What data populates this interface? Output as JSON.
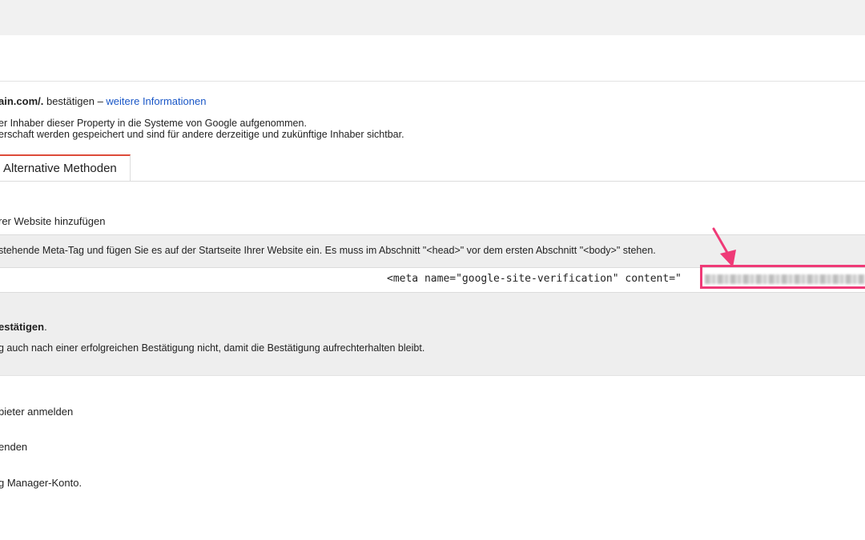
{
  "header": {
    "verify_domain_fragment": "ain.com/.",
    "verify_text": " bestätigen – ",
    "more_info_link": "weitere Informationen"
  },
  "info": {
    "line1": "er Inhaber dieser Property in die Systeme von Google aufgenommen.",
    "line2": "erschaft werden gespeichert und sind für andere derzeitige und zukünftige Inhaber sichtbar."
  },
  "tabs": {
    "active_label": "Alternative Methoden"
  },
  "method": {
    "title": "rer Website hinzufügen",
    "instruction": "stehende Meta-Tag und fügen Sie es auf der Startseite Ihrer Website ein. Es muss im Abschnitt \"<head>\" vor dem ersten Abschnitt \"<body>\" stehen.",
    "meta_code": "<meta name=\"google-site-verification\" content=\""
  },
  "confirm": {
    "title": "estätigen",
    "title_suffix": ".",
    "note": "g auch nach einer erfolgreichen Bestätigung nicht, damit die Bestätigung aufrechterhalten bleibt."
  },
  "options": [
    "bieter anmelden",
    "enden",
    "g Manager-Konto."
  ],
  "colors": {
    "link": "#1a57c7",
    "tab_accent": "#dd4b39",
    "highlight": "#ef3a77"
  }
}
